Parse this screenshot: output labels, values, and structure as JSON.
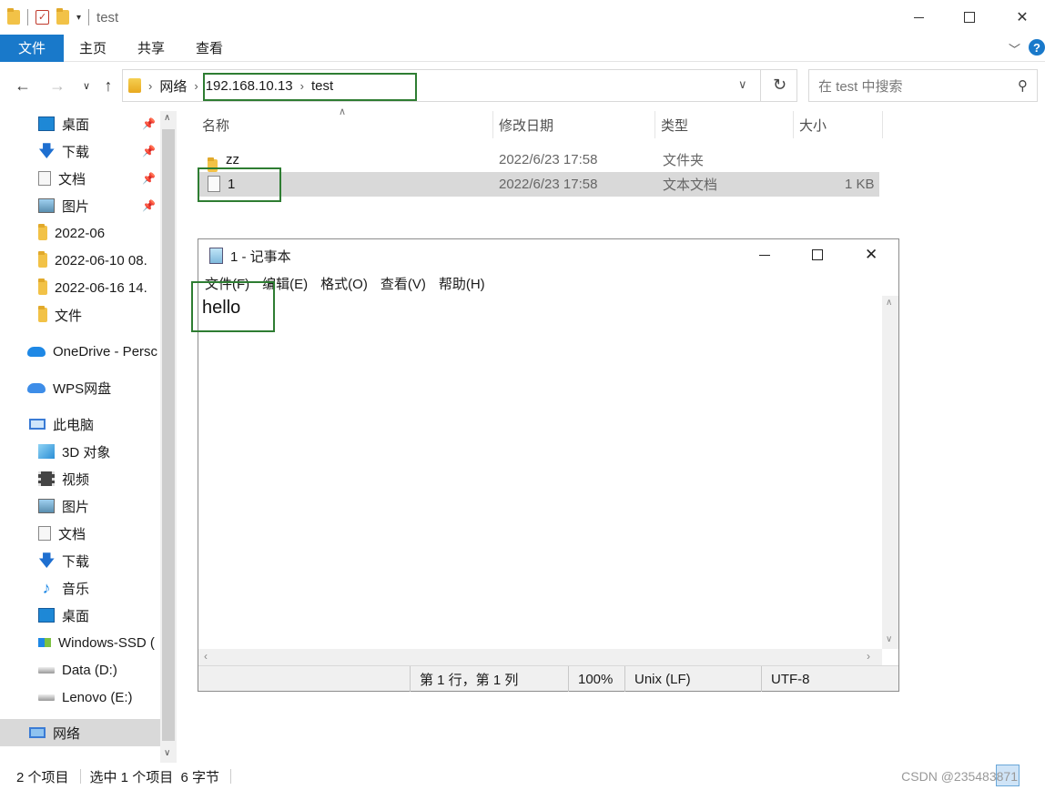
{
  "window": {
    "title": "test",
    "min_icon": "minimize-icon",
    "max_icon": "maximize-icon",
    "close_icon": "close-icon"
  },
  "ribbon": {
    "tabs": [
      "文件",
      "主页",
      "共享",
      "查看"
    ]
  },
  "address": {
    "crumbs": [
      "网络",
      "192.168.10.13",
      "test"
    ],
    "search_placeholder": "在 test 中搜索"
  },
  "sidebar": {
    "items": [
      {
        "label": "桌面",
        "icon": "desktop-icon",
        "pinned": true
      },
      {
        "label": "下载",
        "icon": "download-icon",
        "pinned": true
      },
      {
        "label": "文档",
        "icon": "document-icon",
        "pinned": true
      },
      {
        "label": "图片",
        "icon": "picture-icon",
        "pinned": true
      },
      {
        "label": "2022-06",
        "icon": "folder-icon"
      },
      {
        "label": "2022-06-10 08.",
        "icon": "folder-icon"
      },
      {
        "label": "2022-06-16 14.",
        "icon": "folder-icon"
      },
      {
        "label": "文件",
        "icon": "folder-icon"
      },
      {
        "label": "OneDrive - Persc",
        "icon": "onedrive-icon"
      },
      {
        "label": "WPS网盘",
        "icon": "cloud-icon"
      },
      {
        "label": "此电脑",
        "icon": "computer-icon"
      },
      {
        "label": "3D 对象",
        "icon": "3d-objects-icon"
      },
      {
        "label": "视频",
        "icon": "video-icon"
      },
      {
        "label": "图片",
        "icon": "picture-icon"
      },
      {
        "label": "文档",
        "icon": "document-icon"
      },
      {
        "label": "下载",
        "icon": "download-icon"
      },
      {
        "label": "音乐",
        "icon": "music-icon"
      },
      {
        "label": "桌面",
        "icon": "desktop-icon"
      },
      {
        "label": "Windows-SSD (",
        "icon": "drive-icon"
      },
      {
        "label": "Data (D:)",
        "icon": "drive-icon"
      },
      {
        "label": "Lenovo (E:)",
        "icon": "drive-icon"
      },
      {
        "label": "网络",
        "icon": "network-icon"
      }
    ]
  },
  "filelist": {
    "columns": [
      "名称",
      "修改日期",
      "类型",
      "大小"
    ],
    "rows": [
      {
        "name": "zz",
        "date": "2022/6/23 17:58",
        "type": "文件夹",
        "size": "",
        "icon": "folder-icon"
      },
      {
        "name": "1",
        "date": "2022/6/23 17:58",
        "type": "文本文档",
        "size": "1 KB",
        "icon": "text-file-icon"
      }
    ]
  },
  "notepad": {
    "title": "1 - 记事本",
    "menu": [
      "文件(F)",
      "编辑(E)",
      "格式(O)",
      "查看(V)",
      "帮助(H)"
    ],
    "content": "hello",
    "status": {
      "position": "第 1 行，第 1 列",
      "zoom": "100%",
      "eol": "Unix (LF)",
      "encoding": "UTF-8"
    }
  },
  "statusbar": {
    "count": "2 个项目",
    "selection": "选中 1 个项目  6 字节"
  },
  "watermark": "CSDN @235483871"
}
